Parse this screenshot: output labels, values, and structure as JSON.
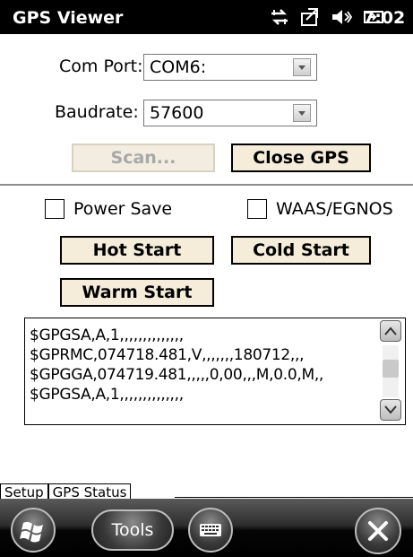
{
  "statusbar": {
    "app_title": "GPS Viewer",
    "time": "7:02",
    "icons": [
      "connectivity-icon",
      "sync-icon",
      "volume-icon",
      "battery-icon"
    ]
  },
  "settings": {
    "com_port_label": "Com Port:",
    "com_port_value": "COM6:",
    "baudrate_label": "Baudrate:",
    "baudrate_value": "57600"
  },
  "buttons": {
    "scan": "Scan...",
    "close_gps": "Close GPS",
    "hot_start": "Hot Start",
    "cold_start": "Cold Start",
    "warm_start": "Warm Start"
  },
  "options": {
    "power_save": "Power Save",
    "power_save_checked": false,
    "waas_egnos": "WAAS/EGNOS",
    "waas_egnos_checked": false
  },
  "log": {
    "lines": [
      "$GPGSA,A,1,,,,,,,,,,,,,,",
      "$GPRMC,074718.481,V,,,,,,,180712,,,",
      "$GPGGA,074719.481,,,,,0,00,,,M,0.0,M,,",
      "$GPGSA,A,1,,,,,,,,,,,,,,"
    ]
  },
  "tabs": [
    "Setup",
    "GPS Status"
  ],
  "bottombar": {
    "tools_label": "Tools"
  },
  "colors": {
    "button_face": "#f5ecd9",
    "status_bar": "#000000",
    "bottom_bar": "#1a1a1a"
  }
}
